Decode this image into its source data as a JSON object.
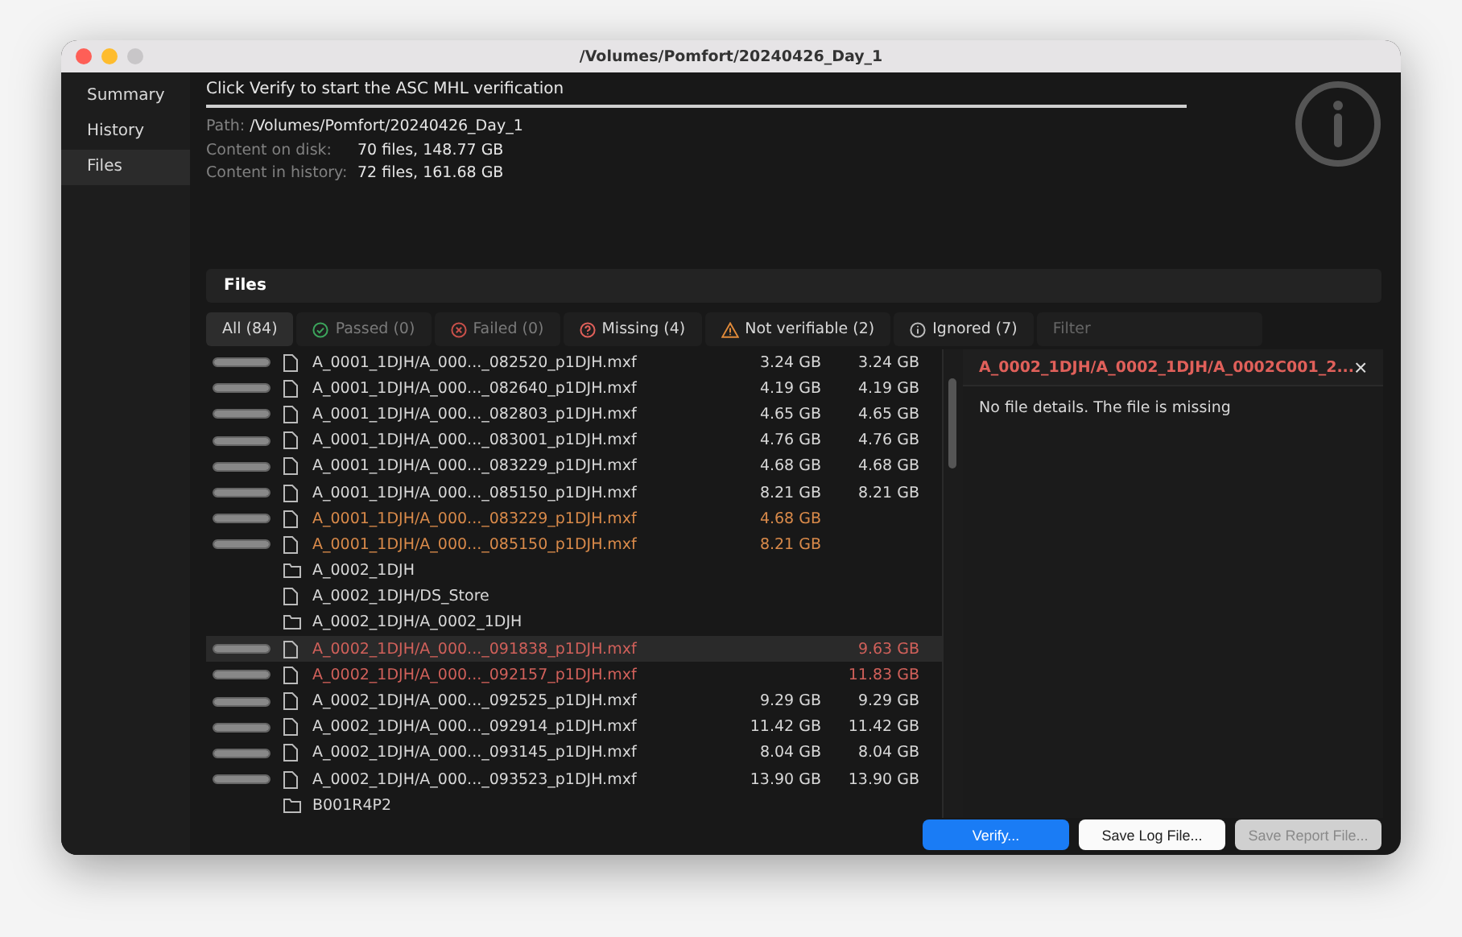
{
  "window": {
    "title": "/Volumes/Pomfort/20240426_Day_1"
  },
  "sidebar": {
    "items": [
      {
        "label": "Summary",
        "selected": false
      },
      {
        "label": "History",
        "selected": false
      },
      {
        "label": "Files",
        "selected": true
      }
    ]
  },
  "status": {
    "message": "Click Verify to start the ASC MHL verification",
    "level": 1
  },
  "info": [
    {
      "label": "Path:",
      "value": "/Volumes/Pomfort/20240426_Day_1"
    },
    {
      "label": "Content on disk:",
      "value": "70 files, 148.77 GB"
    },
    {
      "label": "Content in history:",
      "value": "72 files, 161.68 GB"
    }
  ],
  "files_panel": {
    "title": "Files",
    "tabs": [
      {
        "kind": "all",
        "label": "All (84)",
        "selected": true,
        "disabled": false
      },
      {
        "kind": "passed",
        "label": "Passed (0)",
        "selected": false,
        "disabled": true
      },
      {
        "kind": "failed",
        "label": "Failed (0)",
        "selected": false,
        "disabled": true
      },
      {
        "kind": "missing",
        "label": "Missing (4)",
        "selected": false,
        "disabled": false
      },
      {
        "kind": "not-verifiable",
        "label": "Not verifiable (2)",
        "selected": false,
        "disabled": false
      },
      {
        "kind": "ignored",
        "label": "Ignored (7)",
        "selected": false,
        "disabled": false
      }
    ],
    "filter": {
      "placeholder": "Filter"
    },
    "rows": [
      {
        "kind": "file",
        "color": "#d8d8d8",
        "selected": false,
        "level": 1,
        "name": "A_0001_1DJH/A_000..._082520_p1DJH.mxf",
        "size_disk": "3.24 GB",
        "size_history": "3.24 GB"
      },
      {
        "kind": "file",
        "color": "#d8d8d8",
        "selected": false,
        "level": 1,
        "name": "A_0001_1DJH/A_000..._082640_p1DJH.mxf",
        "size_disk": "4.19 GB",
        "size_history": "4.19 GB"
      },
      {
        "kind": "file",
        "color": "#d8d8d8",
        "selected": false,
        "level": 1,
        "name": "A_0001_1DJH/A_000..._082803_p1DJH.mxf",
        "size_disk": "4.65 GB",
        "size_history": "4.65 GB"
      },
      {
        "kind": "file",
        "color": "#d8d8d8",
        "selected": false,
        "level": 1,
        "name": "A_0001_1DJH/A_000..._083001_p1DJH.mxf",
        "size_disk": "4.76 GB",
        "size_history": "4.76 GB"
      },
      {
        "kind": "file",
        "color": "#d8d8d8",
        "selected": false,
        "level": 1,
        "name": "A_0001_1DJH/A_000..._083229_p1DJH.mxf",
        "size_disk": "4.68 GB",
        "size_history": "4.68 GB"
      },
      {
        "kind": "file",
        "color": "#d8d8d8",
        "selected": false,
        "level": 1,
        "name": "A_0001_1DJH/A_000..._085150_p1DJH.mxf",
        "size_disk": "8.21 GB",
        "size_history": "8.21 GB"
      },
      {
        "kind": "file",
        "color": "#d98a4a",
        "selected": false,
        "level": 1,
        "name": "A_0001_1DJH/A_000..._083229_p1DJH.mxf",
        "size_disk": "4.68 GB"
      },
      {
        "kind": "file",
        "color": "#d98a4a",
        "selected": false,
        "level": 1,
        "name": "A_0001_1DJH/A_000..._085150_p1DJH.mxf",
        "size_disk": "8.21 GB"
      },
      {
        "kind": "folder",
        "color": "#d8d8d8",
        "selected": false,
        "name": "A_0002_1DJH"
      },
      {
        "kind": "file",
        "color": "#d8d8d8",
        "selected": false,
        "name": "A_0002_1DJH/DS_Store"
      },
      {
        "kind": "folder",
        "color": "#d8d8d8",
        "selected": false,
        "name": "A_0002_1DJH/A_0002_1DJH"
      },
      {
        "kind": "file",
        "color": "#d0605a",
        "selected": true,
        "level": 1,
        "name": "A_0002_1DJH/A_000..._091838_p1DJH.mxf",
        "size_history": "9.63 GB"
      },
      {
        "kind": "file",
        "color": "#d0605a",
        "selected": false,
        "level": 1,
        "name": "A_0002_1DJH/A_000..._092157_p1DJH.mxf",
        "size_history": "11.83 GB"
      },
      {
        "kind": "file",
        "color": "#d8d8d8",
        "selected": false,
        "level": 1,
        "name": "A_0002_1DJH/A_000..._092525_p1DJH.mxf",
        "size_disk": "9.29 GB",
        "size_history": "9.29 GB"
      },
      {
        "kind": "file",
        "color": "#d8d8d8",
        "selected": false,
        "level": 1,
        "name": "A_0002_1DJH/A_000..._092914_p1DJH.mxf",
        "size_disk": "11.42 GB",
        "size_history": "11.42 GB"
      },
      {
        "kind": "file",
        "color": "#d8d8d8",
        "selected": false,
        "level": 1,
        "name": "A_0002_1DJH/A_000..._093145_p1DJH.mxf",
        "size_disk": "8.04 GB",
        "size_history": "8.04 GB"
      },
      {
        "kind": "file",
        "color": "#d8d8d8",
        "selected": false,
        "level": 1,
        "name": "A_0002_1DJH/A_000..._093523_p1DJH.mxf",
        "size_disk": "13.90 GB",
        "size_history": "13.90 GB"
      },
      {
        "kind": "folder",
        "color": "#d8d8d8",
        "selected": false,
        "name": "B001R4P2"
      }
    ],
    "details": {
      "title": "A_0002_1DJH/A_0002_1DJH/A_0002C001_2...",
      "close": "×",
      "message": "No file details. The file is missing"
    }
  },
  "buttons": [
    {
      "kind": "primary",
      "label": "Verify...",
      "disabled": false
    },
    {
      "kind": "default",
      "label": "Save Log File...",
      "disabled": false
    },
    {
      "kind": "default",
      "label": "Save Report File...",
      "disabled": true
    }
  ]
}
